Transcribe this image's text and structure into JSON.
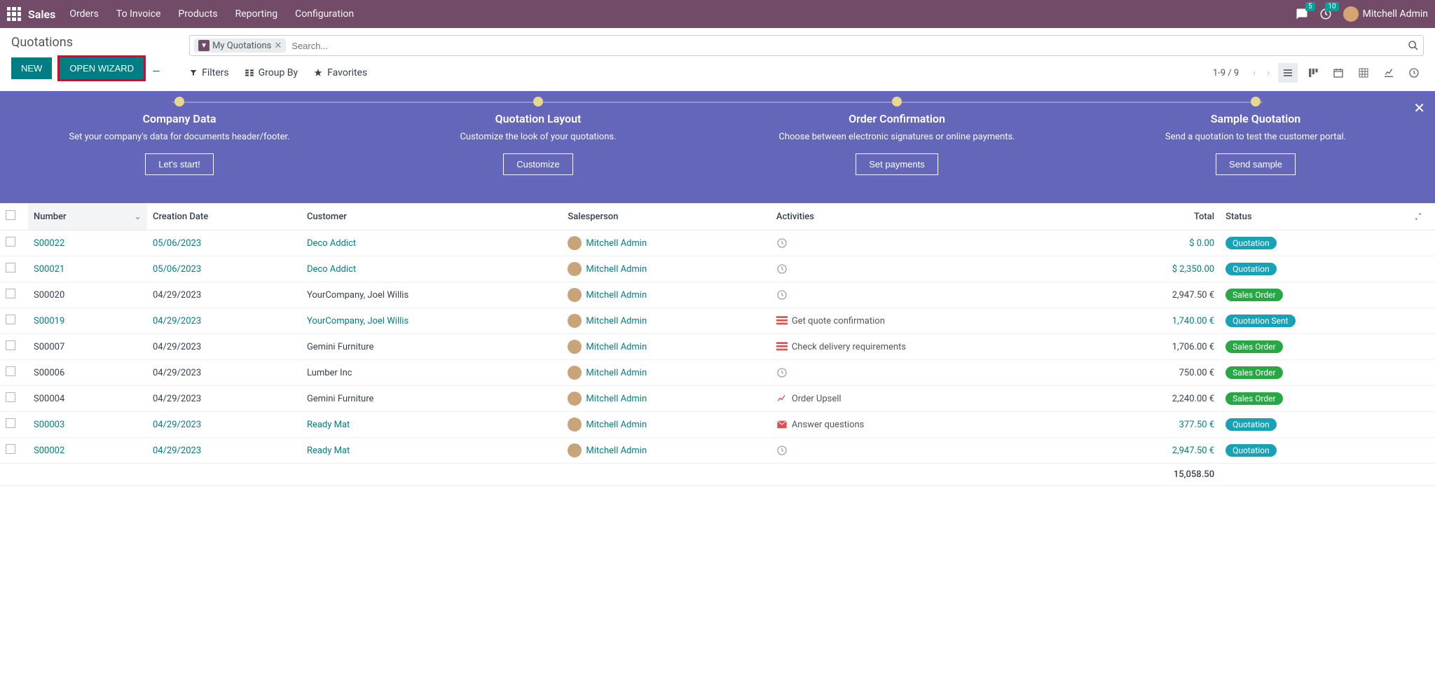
{
  "nav": {
    "brand": "Sales",
    "items": [
      "Orders",
      "To Invoice",
      "Products",
      "Reporting",
      "Configuration"
    ],
    "message_count": "5",
    "activity_count": "10",
    "user": "Mitchell Admin"
  },
  "header": {
    "title": "Quotations",
    "new_btn": "NEW",
    "wizard_btn": "OPEN WIZARD"
  },
  "search": {
    "chip": "My Quotations",
    "placeholder": "Search..."
  },
  "toolbar": {
    "filters": "Filters",
    "group_by": "Group By",
    "favorites": "Favorites",
    "pager": "1-9 / 9"
  },
  "banner": {
    "steps": [
      {
        "title": "Company Data",
        "desc": "Set your company's data for documents header/footer.",
        "btn": "Let's start!"
      },
      {
        "title": "Quotation Layout",
        "desc": "Customize the look of your quotations.",
        "btn": "Customize"
      },
      {
        "title": "Order Confirmation",
        "desc": "Choose between electronic signatures or online payments.",
        "btn": "Set payments"
      },
      {
        "title": "Sample Quotation",
        "desc": "Send a quotation to test the customer portal.",
        "btn": "Send sample"
      }
    ]
  },
  "table": {
    "headers": {
      "number": "Number",
      "date": "Creation Date",
      "customer": "Customer",
      "salesperson": "Salesperson",
      "activities": "Activities",
      "total": "Total",
      "status": "Status"
    },
    "rows": [
      {
        "num": "S00022",
        "date": "05/06/2023",
        "cust": "Deco Addict",
        "sales": "Mitchell Admin",
        "act_icon": "clock",
        "act": "",
        "total": "$ 0.00",
        "status": "Quotation",
        "stc": "teal",
        "link": true
      },
      {
        "num": "S00021",
        "date": "05/06/2023",
        "cust": "Deco Addict",
        "sales": "Mitchell Admin",
        "act_icon": "clock",
        "act": "",
        "total": "$ 2,350.00",
        "status": "Quotation",
        "stc": "teal",
        "link": true
      },
      {
        "num": "S00020",
        "date": "04/29/2023",
        "cust": "YourCompany, Joel Willis",
        "sales": "Mitchell Admin",
        "act_icon": "clock",
        "act": "",
        "total": "2,947.50 €",
        "status": "Sales Order",
        "stc": "green",
        "link": false
      },
      {
        "num": "S00019",
        "date": "04/29/2023",
        "cust": "YourCompany, Joel Willis",
        "sales": "Mitchell Admin",
        "act_icon": "list",
        "act": "Get quote confirmation",
        "total": "1,740.00 €",
        "status": "Quotation Sent",
        "stc": "info",
        "link": true
      },
      {
        "num": "S00007",
        "date": "04/29/2023",
        "cust": "Gemini Furniture",
        "sales": "Mitchell Admin",
        "act_icon": "list",
        "act": "Check delivery requirements",
        "total": "1,706.00 €",
        "status": "Sales Order",
        "stc": "green",
        "link": false
      },
      {
        "num": "S00006",
        "date": "04/29/2023",
        "cust": "Lumber Inc",
        "sales": "Mitchell Admin",
        "act_icon": "clock",
        "act": "",
        "total": "750.00 €",
        "status": "Sales Order",
        "stc": "green",
        "link": false
      },
      {
        "num": "S00004",
        "date": "04/29/2023",
        "cust": "Gemini Furniture",
        "sales": "Mitchell Admin",
        "act_icon": "chart",
        "act": "Order Upsell",
        "total": "2,240.00 €",
        "status": "Sales Order",
        "stc": "green",
        "link": false
      },
      {
        "num": "S00003",
        "date": "04/29/2023",
        "cust": "Ready Mat",
        "sales": "Mitchell Admin",
        "act_icon": "mail",
        "act": "Answer questions",
        "total": "377.50 €",
        "status": "Quotation",
        "stc": "teal",
        "link": true
      },
      {
        "num": "S00002",
        "date": "04/29/2023",
        "cust": "Ready Mat",
        "sales": "Mitchell Admin",
        "act_icon": "clock",
        "act": "",
        "total": "2,947.50 €",
        "status": "Quotation",
        "stc": "teal",
        "link": true
      }
    ],
    "grand_total": "15,058.50"
  }
}
